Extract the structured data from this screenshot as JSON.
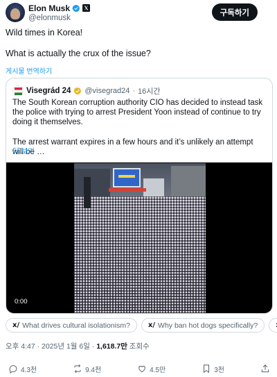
{
  "header": {
    "display_name": "Elon Musk",
    "handle": "@elonmusk",
    "subscribe_label": "구독하기"
  },
  "tweet": {
    "line1": "Wild times in Korea!",
    "line2": "What is actually the crux of the issue?",
    "translate_label": "게시물 번역하기"
  },
  "quote": {
    "name": "Visegrád 24",
    "handle": "@visegrad24",
    "dot": "·",
    "time": "16시간",
    "para1": "The South Korean corruption authority CIO has decided to instead task the police with trying to arrest President Yoon instead of continue to try doing it themselves.",
    "para2": "The arrest warrant expires in a few hours and it’s unlikely an attempt will be …",
    "show_more": "더 보기",
    "video_time": "0:00"
  },
  "suggestions": [
    "What drives cultural isolationism?",
    "Why ban hot dogs specifically?",
    ""
  ],
  "meta": {
    "time_date": "오후 4:47 · 2025년 1월 6일 · ",
    "views_count": "1,618.7만",
    "views_label": " 조회수"
  },
  "actions": {
    "replies": "4.3천",
    "reposts": "9.4천",
    "likes": "4.5만",
    "bookmarks": "3천"
  },
  "colors": {
    "accent": "#1d9bf0",
    "text": "#0f1419",
    "muted": "#536471",
    "border": "#cfd9de",
    "verified_gold": "#e8b923"
  },
  "icons": [
    "verified-badge-icon",
    "x-logo-icon",
    "gold-badge-icon",
    "grok-icon",
    "reply-icon",
    "repost-icon",
    "like-icon",
    "bookmark-icon",
    "share-icon"
  ]
}
